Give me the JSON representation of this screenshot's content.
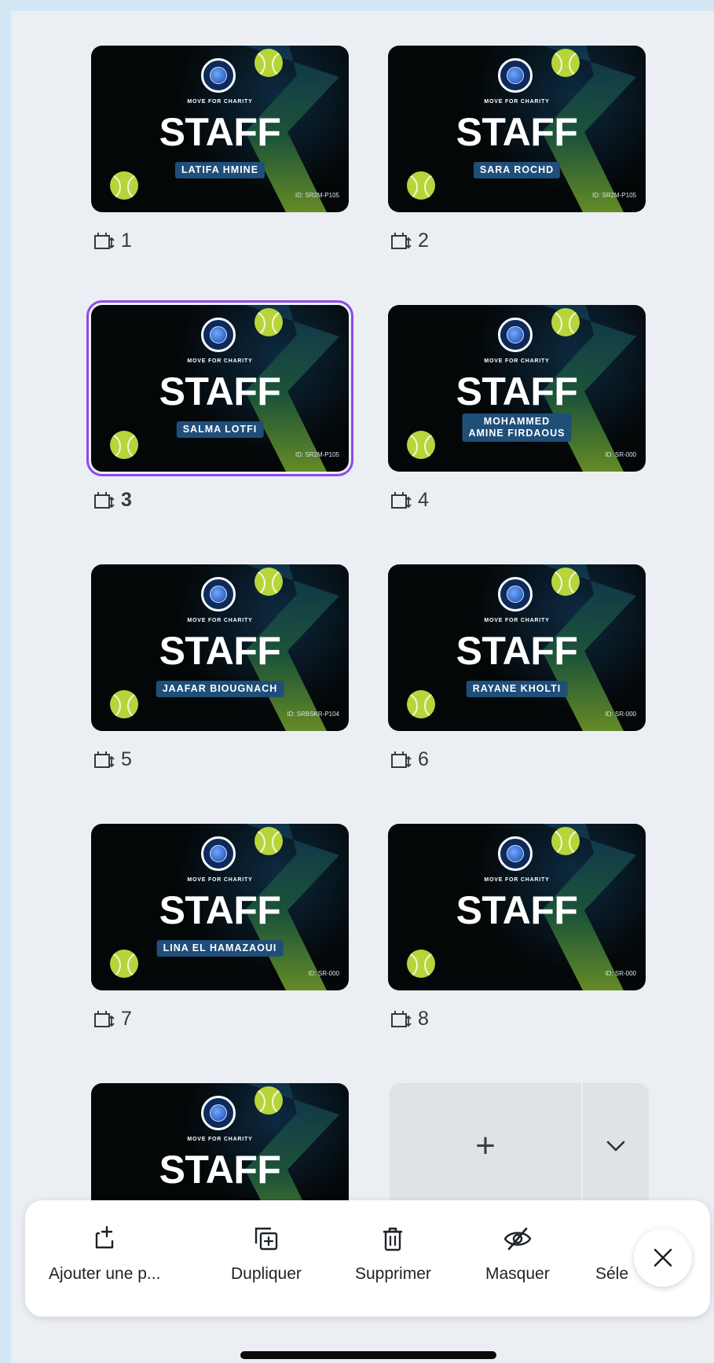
{
  "cards": [
    {
      "brand": "MOVE FOR CHARITY",
      "title": "STAFF",
      "name": "LATIFA HMINE",
      "id": "ID: SR2M-P105",
      "page": "1",
      "selected": false
    },
    {
      "brand": "MOVE FOR CHARITY",
      "title": "STAFF",
      "name": "SARA ROCHD",
      "id": "ID: SR2M-P105",
      "page": "2",
      "selected": false
    },
    {
      "brand": "MOVE FOR CHARITY",
      "title": "STAFF",
      "name": "SALMA LOTFI",
      "id": "ID: SR2M-P105",
      "page": "3",
      "selected": true
    },
    {
      "brand": "MOVE FOR CHARITY",
      "title": "STAFF",
      "name": "MOHAMMED\nAMINE FIRDAOUS",
      "id": "ID: SR-000",
      "page": "4",
      "selected": false
    },
    {
      "brand": "MOVE FOR CHARITY",
      "title": "STAFF",
      "name": "JAAFAR BIOUGNACH",
      "id": "ID: SRBSKR-P104",
      "page": "5",
      "selected": false
    },
    {
      "brand": "MOVE FOR CHARITY",
      "title": "STAFF",
      "name": "RAYANE KHOLTI",
      "id": "ID: SR-000",
      "page": "6",
      "selected": false
    },
    {
      "brand": "MOVE FOR CHARITY",
      "title": "STAFF",
      "name": "LINA EL HAMAZAOUI",
      "id": "ID: SR-000",
      "page": "7",
      "selected": false
    },
    {
      "brand": "MOVE FOR CHARITY",
      "title": "STAFF",
      "name": "",
      "id": "ID: SR-000",
      "page": "8",
      "selected": false
    },
    {
      "brand": "MOVE FOR CHARITY",
      "title": "STAFF",
      "name": "",
      "id": "",
      "page": "",
      "selected": false
    }
  ],
  "add_page": {
    "plus": "+"
  },
  "toolbar": {
    "add_label": "Ajouter une p...",
    "duplicate_label": "Dupliquer",
    "delete_label": "Supprimer",
    "hide_label": "Masquer",
    "select_label": "Séle"
  },
  "colors": {
    "selection": "#8b4be9",
    "card_bg": "#040708",
    "name_bg": "#1f4e79",
    "ball": "#b7d53b"
  }
}
